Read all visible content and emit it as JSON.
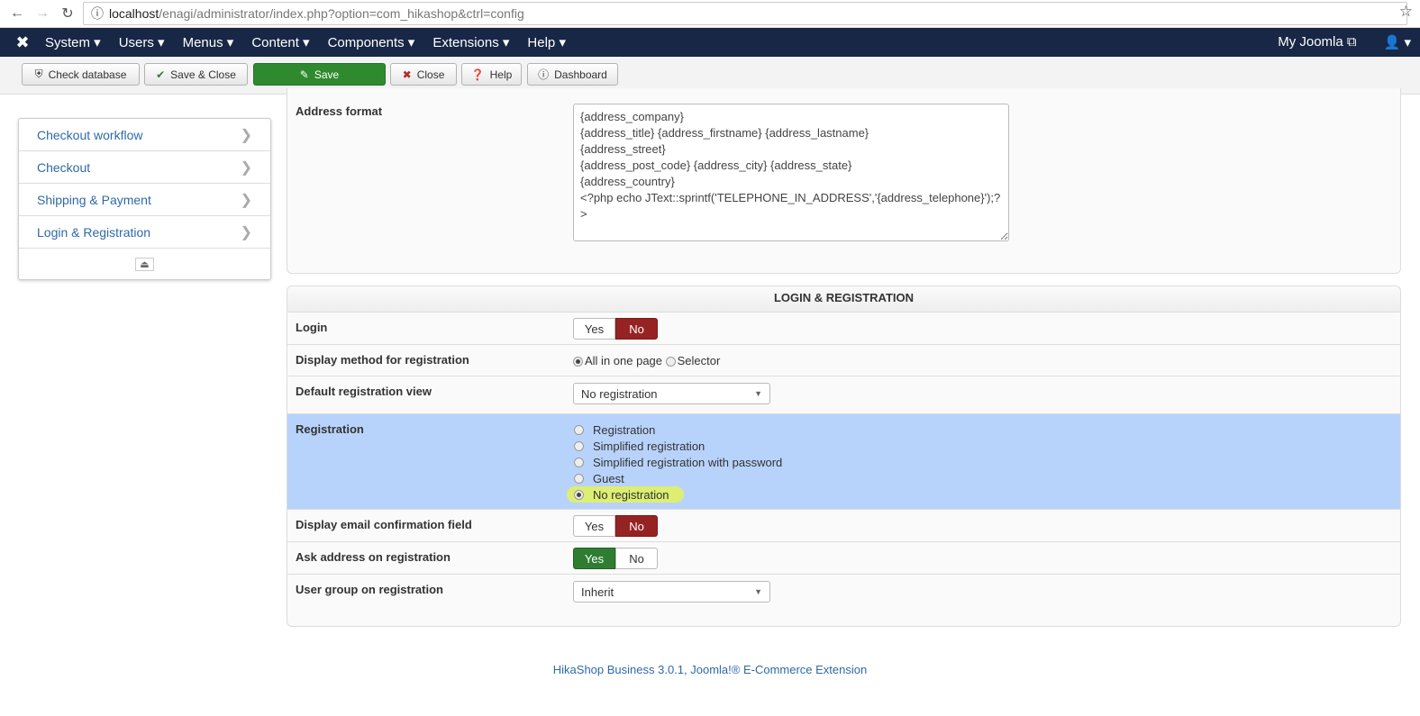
{
  "browser": {
    "url_host": "localhost",
    "url_path": "/enagi/administrator/index.php?option=com_hikashop&ctrl=config"
  },
  "menu": {
    "items": [
      "System",
      "Users",
      "Menus",
      "Content",
      "Components",
      "Extensions",
      "Help"
    ],
    "my_joomla": "My Joomla"
  },
  "toolbar": {
    "check_database": "Check database",
    "save_close": "Save & Close",
    "save": "Save",
    "close": "Close",
    "help": "Help",
    "dashboard": "Dashboard"
  },
  "sidebar": {
    "items": [
      "Checkout workflow",
      "Checkout",
      "Shipping & Payment",
      "Login & Registration"
    ]
  },
  "address": {
    "label": "Address format",
    "value": "{address_company}\n{address_title} {address_firstname} {address_lastname}\n{address_street}\n{address_post_code} {address_city} {address_state}\n{address_country}\n<?php echo JText::sprintf('TELEPHONE_IN_ADDRESS','{address_telephone}');?>"
  },
  "login_reg": {
    "title": "LOGIN & REGISTRATION",
    "login": {
      "label": "Login",
      "yes": "Yes",
      "no": "No",
      "value": "No"
    },
    "display_method": {
      "label": "Display method for registration",
      "options": [
        "All in one page",
        "Selector"
      ],
      "selected": "All in one page"
    },
    "default_view": {
      "label": "Default registration view",
      "value": "No registration"
    },
    "registration": {
      "label": "Registration",
      "options": [
        "Registration",
        "Simplified registration",
        "Simplified registration with password",
        "Guest",
        "No registration"
      ],
      "selected": "No registration"
    },
    "email_confirm": {
      "label": "Display email confirmation field",
      "yes": "Yes",
      "no": "No",
      "value": "No"
    },
    "ask_address": {
      "label": "Ask address on registration",
      "yes": "Yes",
      "no": "No",
      "value": "Yes"
    },
    "user_group": {
      "label": "User group on registration",
      "value": "Inherit"
    }
  },
  "footer": "HikaShop Business 3.0.1, Joomla!® E-Commerce Extension"
}
